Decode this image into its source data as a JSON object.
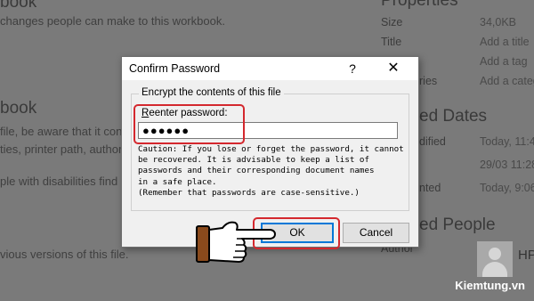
{
  "background": {
    "lines": [
      {
        "text": "book",
        "kind": "head"
      },
      {
        "text": "changes people can make to this workbook.",
        "kind": "text"
      },
      {
        "text": "book",
        "kind": "head"
      },
      {
        "text": "file, be aware that it con",
        "kind": "text"
      },
      {
        "text": "ties, printer path, author",
        "kind": "text"
      },
      {
        "text": "ple with disabilities find c",
        "kind": "text"
      },
      {
        "text": "vious versions of this file.",
        "kind": "text"
      }
    ],
    "properties_heading": "Properties",
    "properties": [
      {
        "label": "Size",
        "value": "34,0KB"
      },
      {
        "label": "Title",
        "value": "Add a title"
      },
      {
        "label": "",
        "value": "Add a tag"
      },
      {
        "label": "ries",
        "value": "Add a categ"
      }
    ],
    "related_dates_heading": "ed Dates",
    "dates": [
      {
        "label": "dified",
        "value": "Today, 11:4"
      },
      {
        "label": "",
        "value": "29/03 11:28"
      },
      {
        "label": "nted",
        "value": "Today, 9:06"
      }
    ],
    "related_people_heading": "ed People",
    "author_label": "Author",
    "author_name": "HP",
    "watermark": "Kiemtung.vn"
  },
  "dialog": {
    "title": "Confirm Password",
    "help": "?",
    "close": "✕",
    "group_caption": "Encrypt the contents of this file",
    "reenter_label_underlined": "R",
    "reenter_label_rest": "eenter password:",
    "password_value": "●●●●●●",
    "caution": "Caution: If you lose or forget the password, it cannot\nbe recovered. It is advisable to keep a list of\npasswords and their corresponding document names\nin a safe place.\n(Remember that passwords are case-sensitive.)",
    "ok_label": "OK",
    "cancel_label": "Cancel"
  },
  "colors": {
    "highlight": "#d4282e",
    "focus": "#0078d7",
    "overlay": "#7a7a7a"
  },
  "icons": {
    "pointer": "pointing-hand-icon",
    "avatar": "user-avatar-icon"
  }
}
